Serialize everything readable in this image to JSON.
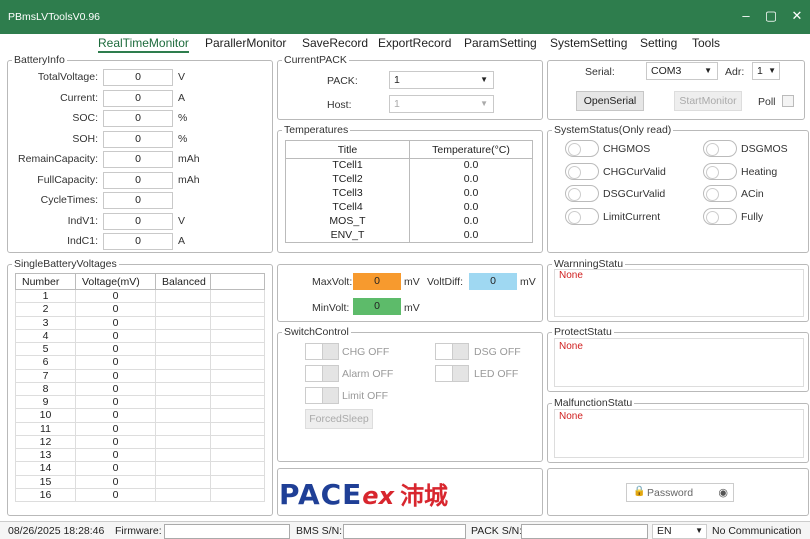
{
  "app": {
    "title": "PBmsLVToolsV0.96"
  },
  "menu": [
    "RealTimeMonitor",
    "ParallerMonitor",
    "SaveRecord",
    "ExportRecord",
    "ParamSetting",
    "SystemSetting",
    "Setting",
    "Tools"
  ],
  "battery_info": {
    "title": "BatteryInfo",
    "rows": [
      {
        "label": "TotalVoltage:",
        "value": "0",
        "unit": "V"
      },
      {
        "label": "Current:",
        "value": "0",
        "unit": "A"
      },
      {
        "label": "SOC:",
        "value": "0",
        "unit": "%"
      },
      {
        "label": "SOH:",
        "value": "0",
        "unit": "%"
      },
      {
        "label": "RemainCapacity:",
        "value": "0",
        "unit": "mAh"
      },
      {
        "label": "FullCapacity:",
        "value": "0",
        "unit": "mAh"
      },
      {
        "label": "CycleTimes:",
        "value": "0",
        "unit": ""
      },
      {
        "label": "IndV1:",
        "value": "0",
        "unit": "V"
      },
      {
        "label": "IndC1:",
        "value": "0",
        "unit": "A"
      }
    ]
  },
  "current_pack": {
    "title": "CurrentPACK",
    "pack_label": "PACK:",
    "pack_value": "1",
    "host_label": "Host:",
    "host_value": "1"
  },
  "connection": {
    "serial_label": "Serial:",
    "serial_value": "COM3",
    "adr_label": "Adr:",
    "adr_value": "1",
    "open_serial": "OpenSerial",
    "start_monitor": "StartMonitor",
    "poll_label": "Poll"
  },
  "temperatures": {
    "title": "Temperatures",
    "headers": [
      "Title",
      "Temperature(°C)"
    ],
    "rows": [
      [
        "TCell1",
        "0.0"
      ],
      [
        "TCell2",
        "0.0"
      ],
      [
        "TCell3",
        "0.0"
      ],
      [
        "TCell4",
        "0.0"
      ],
      [
        "MOS_T",
        "0.0"
      ],
      [
        "ENV_T",
        "0.0"
      ]
    ]
  },
  "system_status": {
    "title": "SystemStatus(Only read)",
    "items": [
      "CHGMOS",
      "DSGMOS",
      "CHGCurValid",
      "Heating",
      "DSGCurValid",
      "ACin",
      "LimitCurrent",
      "Fully"
    ]
  },
  "single_voltages": {
    "title": "SingleBatteryVoltages",
    "headers": [
      "Number",
      "Voltage(mV)",
      "Balanced"
    ],
    "rows": [
      [
        "1",
        "0"
      ],
      [
        "2",
        "0"
      ],
      [
        "3",
        "0"
      ],
      [
        "4",
        "0"
      ],
      [
        "5",
        "0"
      ],
      [
        "6",
        "0"
      ],
      [
        "7",
        "0"
      ],
      [
        "8",
        "0"
      ],
      [
        "9",
        "0"
      ],
      [
        "10",
        "0"
      ],
      [
        "11",
        "0"
      ],
      [
        "12",
        "0"
      ],
      [
        "13",
        "0"
      ],
      [
        "14",
        "0"
      ],
      [
        "15",
        "0"
      ],
      [
        "16",
        "0"
      ]
    ]
  },
  "volt_summary": {
    "max_label": "MaxVolt:",
    "max_value": "0",
    "max_unit": "mV",
    "diff_label": "VoltDiff:",
    "diff_value": "0",
    "diff_unit": "mV",
    "min_label": "MinVolt:",
    "min_value": "0",
    "min_unit": "mV",
    "max_color": "#f79a2e",
    "diff_color": "#9fd8f2",
    "min_color": "#5dbb6a"
  },
  "switch_control": {
    "title": "SwitchControl",
    "chg": "CHG OFF",
    "dsg": "DSG OFF",
    "alarm": "Alarm OFF",
    "led": "LED OFF",
    "limit": "Limit OFF",
    "forced_sleep": "ForcedSleep"
  },
  "warning": {
    "title": "WarnningStatu",
    "value": "None"
  },
  "protect": {
    "title": "ProtectStatu",
    "value": "None"
  },
  "malfunction": {
    "title": "MalfunctionStatu",
    "value": "None"
  },
  "logo": {
    "brand": "PACE",
    "suffix": "ex",
    "cn": "沛城"
  },
  "password": {
    "placeholder": "Password"
  },
  "status_bar": {
    "datetime": "08/26/2025 18:28:46",
    "firmware_label": "Firmware:",
    "bms_sn_label": "BMS S/N:",
    "pack_sn_label": "PACK S/N:",
    "language": "EN",
    "comm_status": "No Communication"
  },
  "colors": {
    "title_bar": "#2e7d4d",
    "none_text": "#d02020",
    "logo_blue": "#1f3f96",
    "logo_red": "#d8262e"
  }
}
